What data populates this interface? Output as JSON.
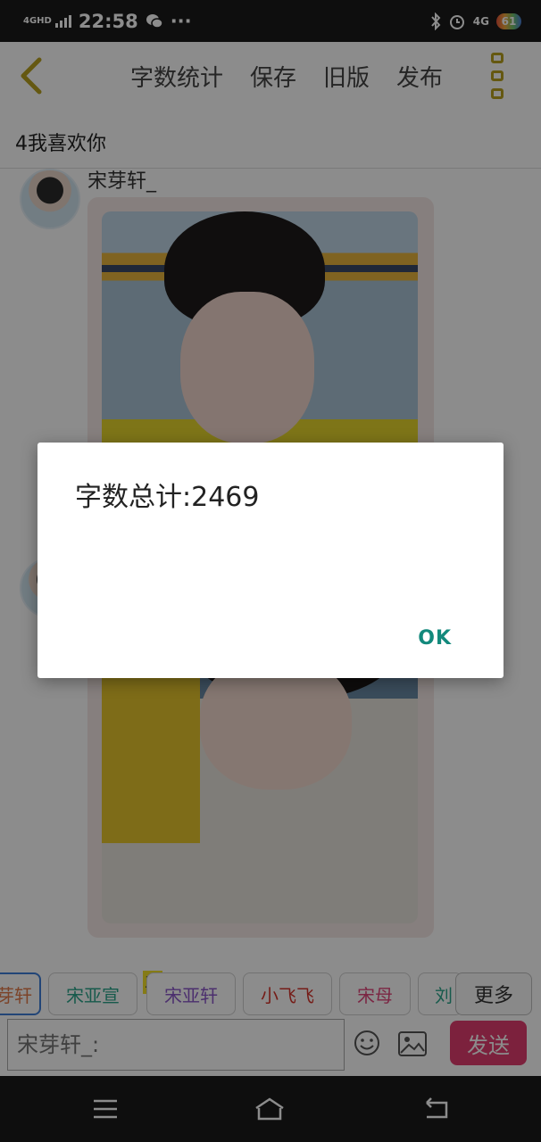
{
  "status_bar": {
    "network": "4GHD",
    "time": "22:58",
    "more": "···",
    "right_network": "4G",
    "battery": "61"
  },
  "toolbar": {
    "word_count_label": "字数统计",
    "save_label": "保存",
    "old_version_label": "旧版",
    "publish_label": "发布"
  },
  "document": {
    "title": "4我喜欢你"
  },
  "chat": {
    "messages": [
      {
        "sender": "宋芽轩_"
      }
    ]
  },
  "dialog": {
    "message": "字数总计:2469",
    "ok_label": "OK"
  },
  "characters": {
    "crown_label": "主",
    "items": [
      {
        "name": "宋芽轩_",
        "color": "#3f7fd9"
      },
      {
        "name": "宋亚宣",
        "color": "#2aa58a"
      },
      {
        "name": "宋亚轩",
        "color": "#8a56c9"
      },
      {
        "name": "小飞飞",
        "color": "#d6332b"
      },
      {
        "name": "宋母",
        "color": "#e0457a"
      },
      {
        "name": "刘",
        "color": "#2aa58a"
      }
    ],
    "more_label": "更多"
  },
  "composer": {
    "placeholder": "宋芽轩_:",
    "send_label": "发送"
  },
  "colors": {
    "accent_gold": "#b9a11f",
    "send_button": "#e23d6f",
    "dialog_ok": "#13897c"
  }
}
